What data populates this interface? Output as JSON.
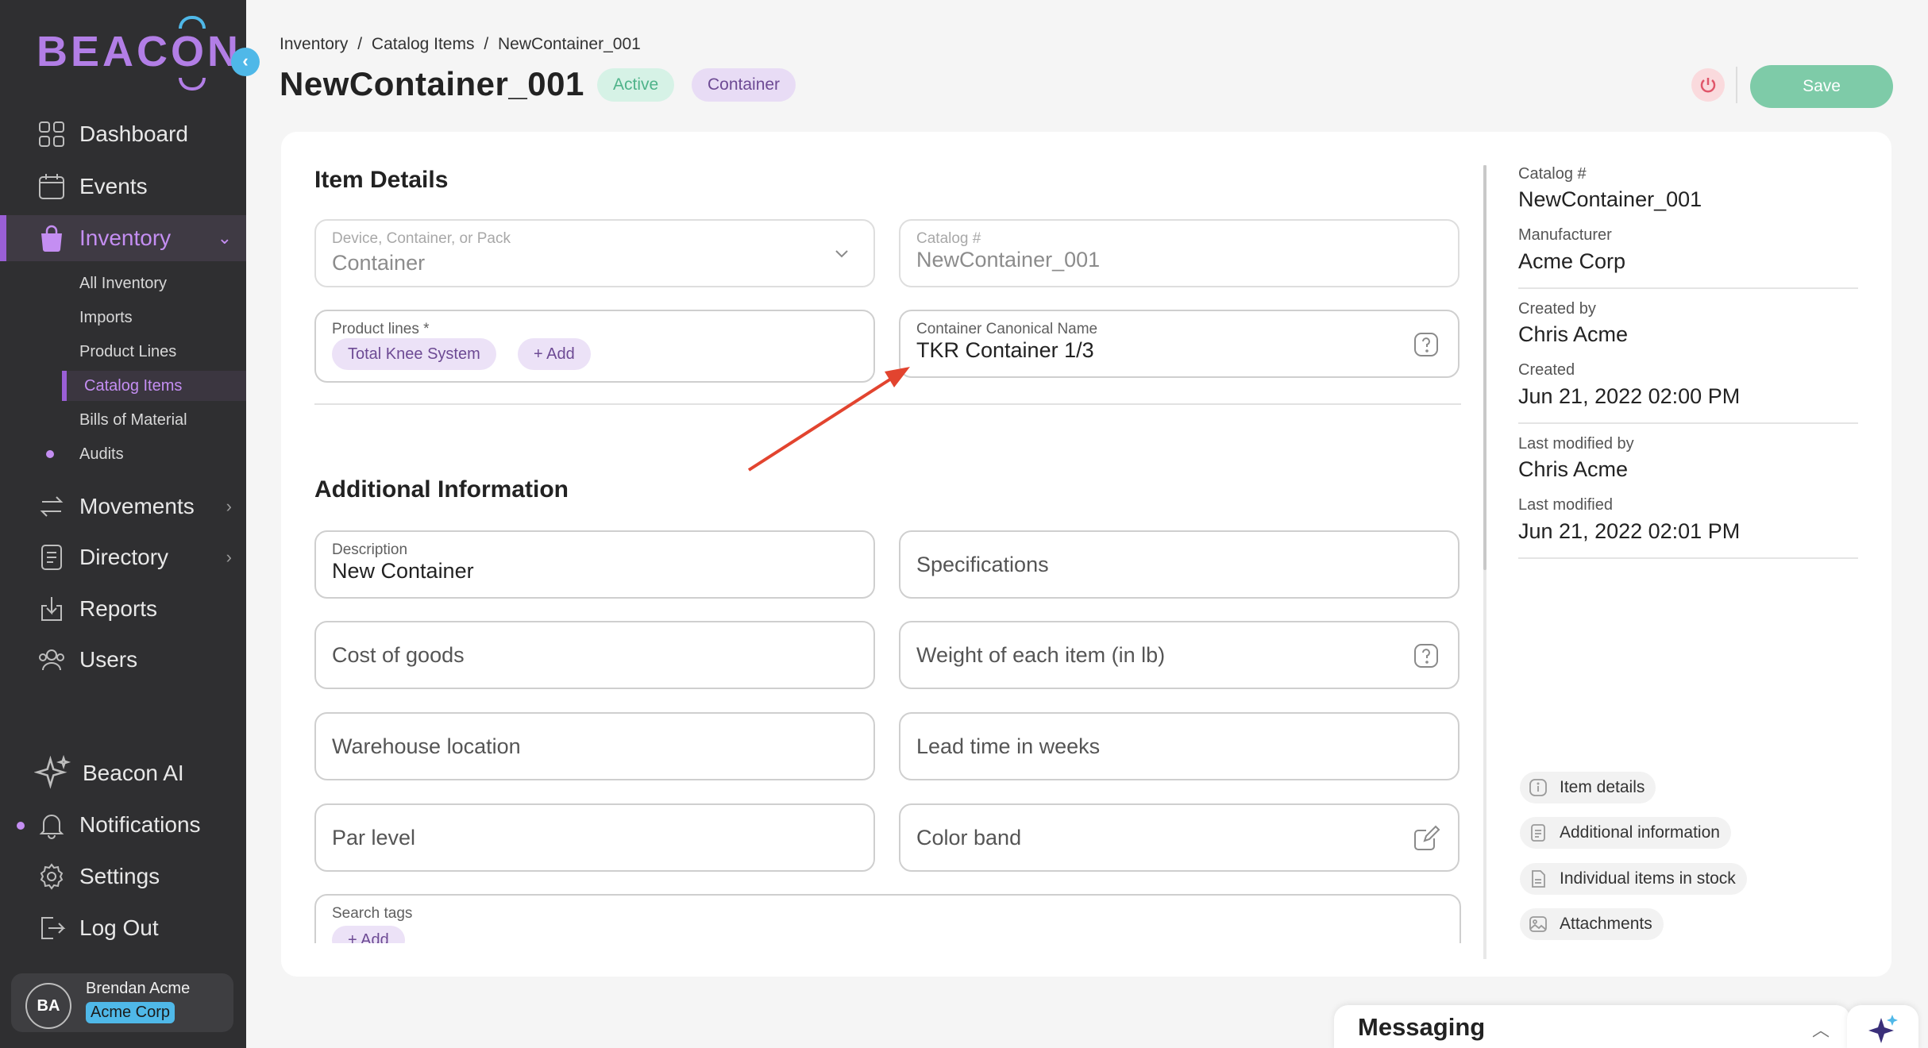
{
  "brand": {
    "logo_text": "BEACON"
  },
  "sidebar": {
    "collapse_icon": "chevron-left",
    "nav": [
      {
        "label": "Dashboard",
        "icon": "grid-icon"
      },
      {
        "label": "Events",
        "icon": "calendar-icon"
      },
      {
        "label": "Inventory",
        "icon": "bag-icon"
      },
      {
        "label": "Movements",
        "icon": "arrows-icon"
      },
      {
        "label": "Directory",
        "icon": "book-icon"
      },
      {
        "label": "Reports",
        "icon": "download-icon"
      },
      {
        "label": "Users",
        "icon": "users-icon"
      },
      {
        "label": "Beacon AI",
        "icon": "sparkle-icon"
      },
      {
        "label": "Notifications",
        "icon": "bell-icon"
      },
      {
        "label": "Settings",
        "icon": "gear-icon"
      },
      {
        "label": "Log Out",
        "icon": "logout-icon"
      }
    ],
    "inventory_sub": [
      "All Inventory",
      "Imports",
      "Product Lines",
      "Catalog Items",
      "Bills of Material",
      "Audits"
    ],
    "user": {
      "initials": "BA",
      "name": "Brendan Acme",
      "org": "Acme Corp"
    }
  },
  "header": {
    "breadcrumb": [
      "Inventory",
      "/",
      "Catalog Items",
      "/",
      "NewContainer_001"
    ],
    "title": "NewContainer_001",
    "status_badge": "Active",
    "type_badge": "Container",
    "save_label": "Save"
  },
  "item_details": {
    "title": "Item Details",
    "type_field": {
      "label": "Device, Container, or Pack",
      "value": "Container"
    },
    "catalog_field": {
      "label": "Catalog #",
      "value": "NewContainer_001"
    },
    "product_lines": {
      "label": "Product lines *",
      "chips": [
        "Total Knee System"
      ],
      "add_label": "+ Add"
    },
    "canonical_name": {
      "label": "Container Canonical Name",
      "value": "TKR Container 1/3"
    }
  },
  "additional_info": {
    "title": "Additional Information",
    "description": {
      "label": "Description",
      "value": "New Container"
    },
    "specifications_placeholder": "Specifications",
    "cost_placeholder": "Cost of goods",
    "weight_placeholder": "Weight of each item (in lb)",
    "warehouse_placeholder": "Warehouse location",
    "lead_time_placeholder": "Lead time in weeks",
    "par_level_placeholder": "Par level",
    "color_band_placeholder": "Color band",
    "search_tags": {
      "label": "Search tags",
      "add_label": "+ Add"
    }
  },
  "meta": {
    "catalog_label": "Catalog #",
    "catalog_value": "NewContainer_001",
    "manufacturer_label": "Manufacturer",
    "manufacturer_value": "Acme Corp",
    "created_by_label": "Created by",
    "created_by_value": "Chris Acme",
    "created_label": "Created",
    "created_value": "Jun 21, 2022 02:00 PM",
    "modified_by_label": "Last modified by",
    "modified_by_value": "Chris Acme",
    "modified_label": "Last modified",
    "modified_value": "Jun 21, 2022 02:01 PM"
  },
  "jump_links": [
    "Item details",
    "Additional information",
    "Individual items in stock",
    "Attachments"
  ],
  "messaging": {
    "title": "Messaging"
  },
  "colors": {
    "accent": "#9a5fd6",
    "sidebar_bg": "#2f2f31",
    "save": "#7ecba8",
    "annotation_arrow": "#e2442f",
    "info_blue": "#4fb8e8"
  }
}
